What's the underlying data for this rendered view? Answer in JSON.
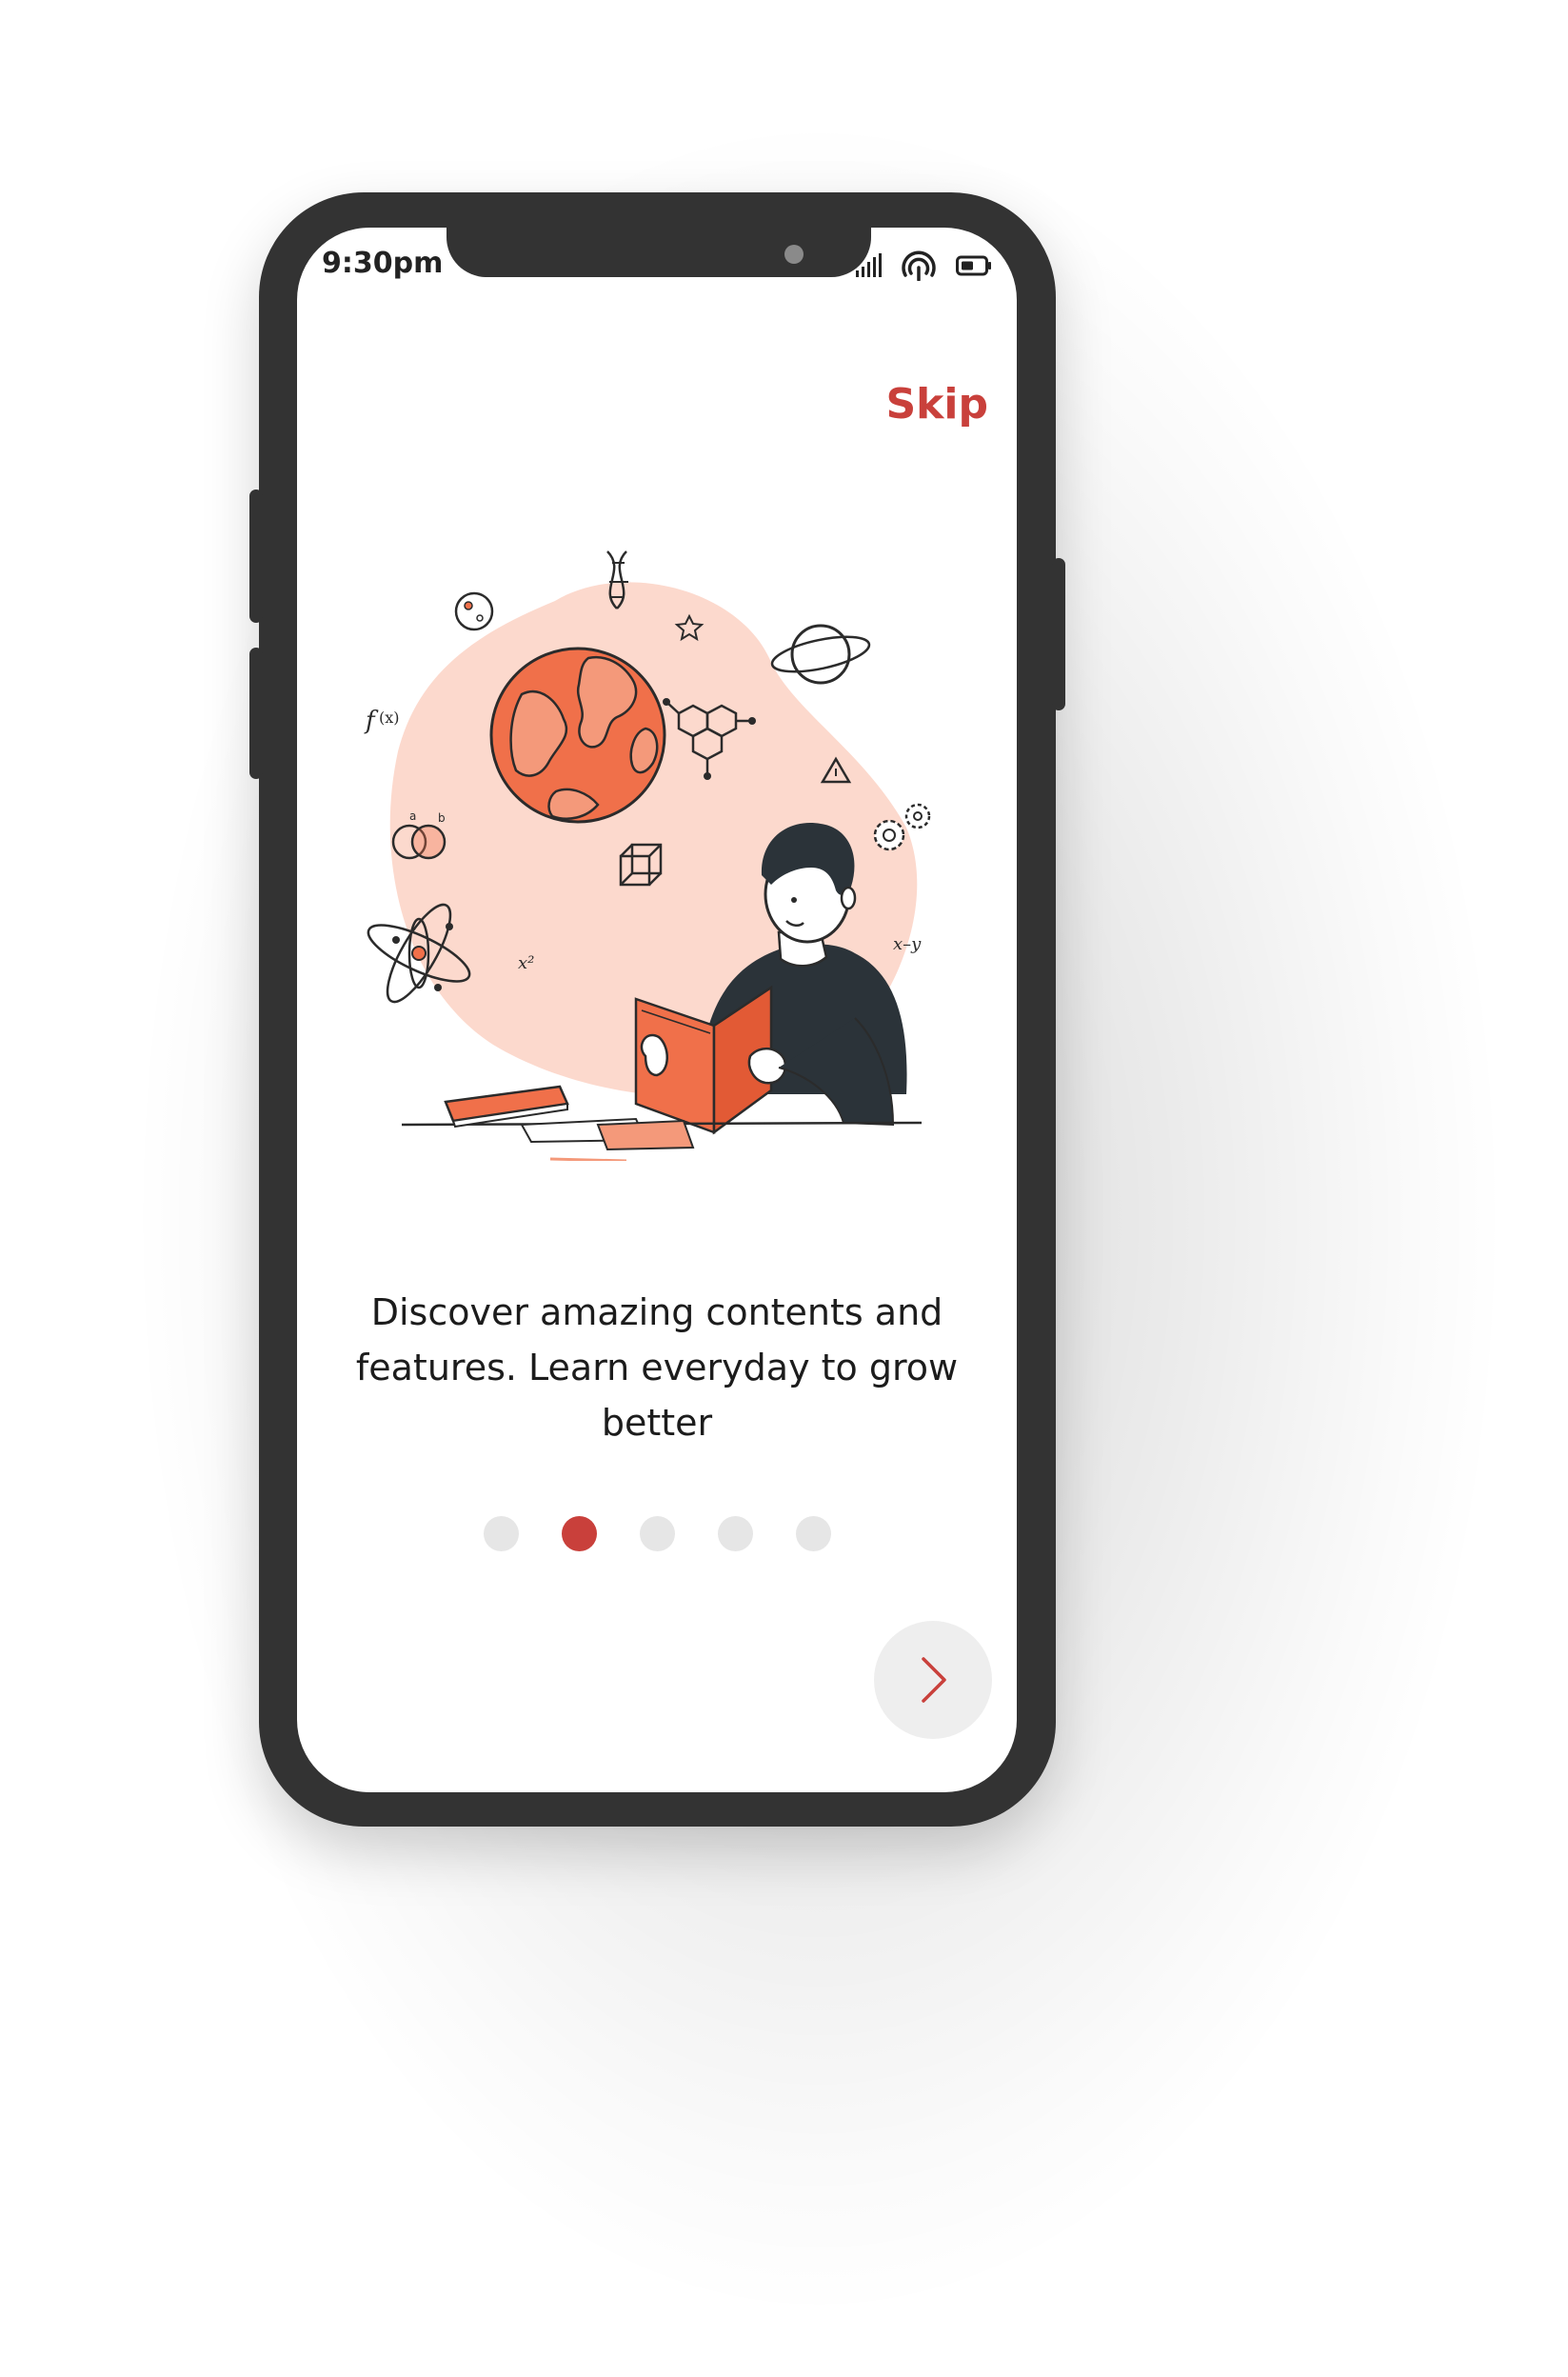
{
  "status_bar": {
    "time": "9:30pm",
    "icons": [
      "signal-icon",
      "hotspot-icon",
      "battery-icon"
    ]
  },
  "onboarding": {
    "skip_label": "Skip",
    "illustration": "man-reading-book-science-illustration",
    "caption": "Discover amazing contents and features. Learn everyday to grow better",
    "pages": {
      "count": 5,
      "active": 2
    },
    "next_icon": "chevron-right-icon"
  },
  "colors": {
    "accent": "#c9403b",
    "illustration_blob": "#fcd9cd",
    "illustration_orange": "#f0704a",
    "frame": "#333333",
    "dot_inactive": "#e6e6e6",
    "next_button_bg": "#eeeeee"
  }
}
